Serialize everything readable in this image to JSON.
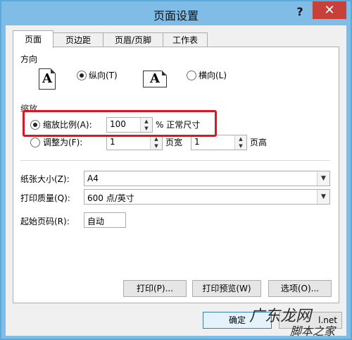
{
  "window": {
    "title": "页面设置",
    "help_glyph": "?",
    "close_glyph": "✕"
  },
  "tabs": [
    {
      "label": "页面",
      "active": true
    },
    {
      "label": "页边距",
      "active": false
    },
    {
      "label": "页眉/页脚",
      "active": false
    },
    {
      "label": "工作表",
      "active": false
    }
  ],
  "orientation": {
    "section_label": "方向",
    "portrait_label": "纵向(T)",
    "landscape_label": "横向(L)",
    "selected": "portrait",
    "icon_letter": "A"
  },
  "scaling": {
    "section_label": "缩放",
    "adjust_to_label": "缩放比例(A):",
    "adjust_value": "100",
    "adjust_suffix": "% 正常尺寸",
    "fit_to_label": "调整为(F):",
    "pages_wide_value": "1",
    "pages_wide_suffix": "页宽",
    "pages_tall_value": "1",
    "pages_tall_suffix": "页高",
    "selected": "adjust_to"
  },
  "paper_size": {
    "label": "纸张大小(Z):",
    "value": "A4"
  },
  "print_quality": {
    "label": "打印质量(Q):",
    "value": "600 点/英寸"
  },
  "first_page_number": {
    "label": "起始页码(R):",
    "value": "自动"
  },
  "buttons": {
    "print": "打印(P)...",
    "print_preview": "打印预览(W)",
    "options": "选项(O)...",
    "ok": "确定",
    "cancel_partial": "l.net"
  },
  "watermark": {
    "line1": "广东龙网",
    "line2": "脚本之家"
  },
  "colors": {
    "title_bar": "#7fbde6",
    "close_button": "#c7403a",
    "highlight_box": "#e0141c"
  }
}
